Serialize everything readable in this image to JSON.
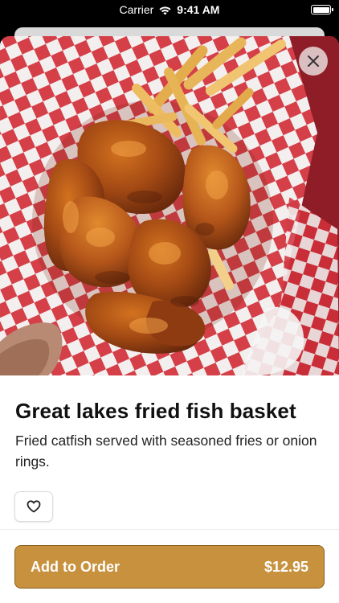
{
  "status_bar": {
    "carrier": "Carrier",
    "time": "9:41 AM"
  },
  "item": {
    "image_alt": "Basket of fried wings with fries on checkered paper",
    "title": "Great lakes fried fish basket",
    "description": "Fried catfish served with seasoned fries or onion rings."
  },
  "actions": {
    "add_to_order_label": "Add to Order",
    "price": "$12.95"
  },
  "icons": {
    "close": "close-icon",
    "favorite": "heart-icon",
    "wifi": "wifi-icon",
    "battery": "battery-icon"
  },
  "colors": {
    "accent": "#c8913e",
    "accent_border": "#8a5f1c",
    "paper_red": "#d2333d"
  }
}
